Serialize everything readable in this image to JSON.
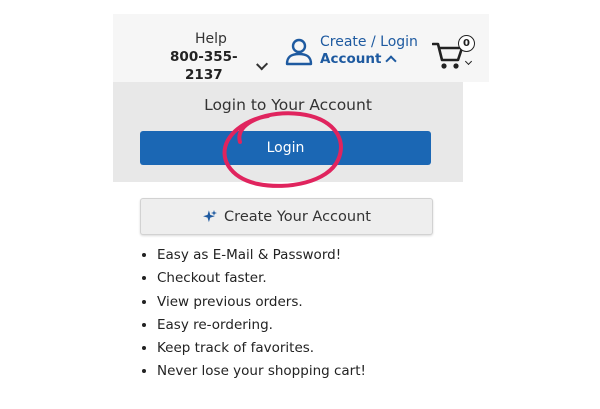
{
  "header": {
    "help_label": "Help",
    "phone": "800-355-2137",
    "account_top": "Create / Login",
    "account_bottom": "Account",
    "cart_count": "0"
  },
  "login_panel": {
    "title": "Login to Your Account",
    "button_label": "Login"
  },
  "create_account": {
    "button_label": "Create Your Account"
  },
  "benefits": [
    "Easy as E-Mail & Password!",
    "Checkout faster.",
    "View previous orders.",
    "Easy re-ordering.",
    "Keep track of favorites.",
    "Never lose your shopping cart!"
  ],
  "colors": {
    "brand_blue": "#1b67b4",
    "link_blue": "#1e5aa0",
    "marker_red": "#e0245e"
  },
  "icons": {
    "account": "user-icon",
    "cart": "cart-icon",
    "create": "sparkle-icon"
  }
}
